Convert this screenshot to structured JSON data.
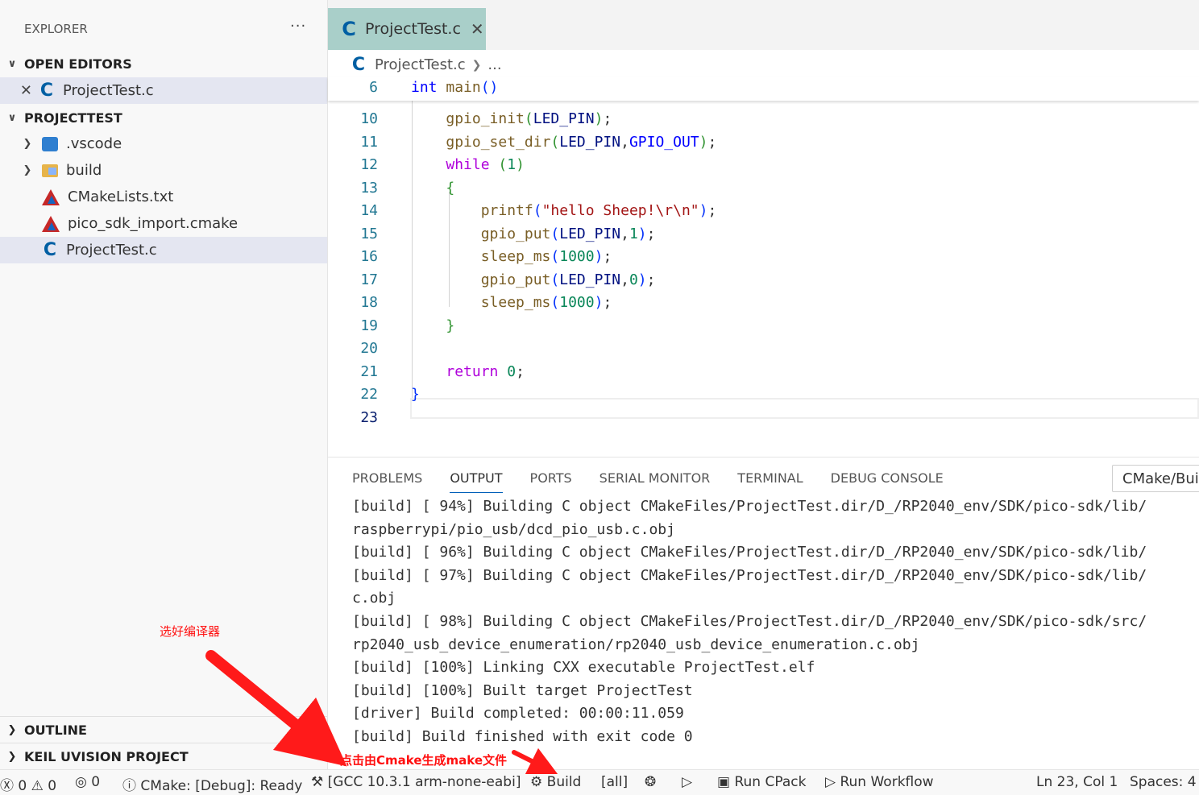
{
  "sidebar": {
    "title": "EXPLORER",
    "more": "···",
    "open_editors": {
      "header": "OPEN EDITORS",
      "items": [
        {
          "label": "ProjectTest.c"
        }
      ]
    },
    "project": {
      "header": "PROJECTTEST",
      "items": [
        {
          "label": ".vscode",
          "icon": "vscode-folder-icon"
        },
        {
          "label": "build",
          "icon": "folder-icon"
        },
        {
          "label": "CMakeLists.txt",
          "icon": "cmake-icon"
        },
        {
          "label": "pico_sdk_import.cmake",
          "icon": "cmake-icon"
        },
        {
          "label": "ProjectTest.c",
          "icon": "c-file-icon"
        }
      ]
    },
    "outline": "OUTLINE",
    "keil": "KEIL UVISION PROJECT"
  },
  "tab": {
    "label": "ProjectTest.c"
  },
  "breadcrumb": {
    "file": "ProjectTest.c",
    "rest": "..."
  },
  "code": {
    "sticky": {
      "line": "6"
    },
    "line_numbers": [
      "10",
      "11",
      "12",
      "13",
      "14",
      "15",
      "16",
      "17",
      "18",
      "19",
      "20",
      "21",
      "22",
      "23"
    ],
    "current_line": "23"
  },
  "panel": {
    "tabs": [
      "PROBLEMS",
      "OUTPUT",
      "PORTS",
      "SERIAL MONITOR",
      "TERMINAL",
      "DEBUG CONSOLE"
    ],
    "active_tab": "OUTPUT",
    "channel": "CMake/Build",
    "output": [
      "[build] [ 94%] Building C object CMakeFiles/ProjectTest.dir/D_/RP2040_env/SDK/pico-sdk/lib/",
      "raspberrypi/pio_usb/dcd_pio_usb.c.obj",
      "[build] [ 96%] Building C object CMakeFiles/ProjectTest.dir/D_/RP2040_env/SDK/pico-sdk/lib/",
      "[build] [ 97%] Building C object CMakeFiles/ProjectTest.dir/D_/RP2040_env/SDK/pico-sdk/lib/",
      "c.obj",
      "[build] [ 98%] Building C object CMakeFiles/ProjectTest.dir/D_/RP2040_env/SDK/pico-sdk/src/",
      "rp2040_usb_device_enumeration/rp2040_usb_device_enumeration.c.obj",
      "[build] [100%] Linking CXX executable ProjectTest.elf",
      "[build] [100%] Built target ProjectTest",
      "[driver] Build completed: 00:00:11.059",
      "[build] Build finished with exit code 0"
    ]
  },
  "status": {
    "errors": "0",
    "warnings": "0",
    "ports": "0",
    "cmake": "CMake: [Debug]: Ready",
    "kit": "[GCC 10.3.1 arm-none-eabi]",
    "build": "Build",
    "target": "[all]",
    "cpack": "Run CPack",
    "workflow": "Run Workflow",
    "position": "Ln 23, Col 1",
    "spaces": "Spaces: 4"
  },
  "annotations": {
    "select_compiler": "选好编译器",
    "click_build": "点击由Cmake生成make文件",
    "color": "#ff1010"
  }
}
